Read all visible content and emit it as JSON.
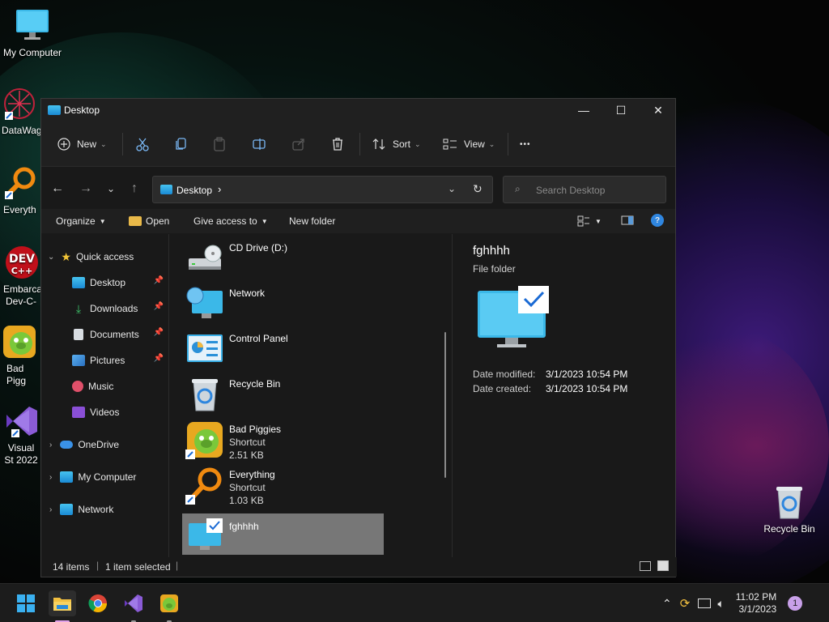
{
  "desktop": {
    "icons": [
      {
        "label": "My Computer"
      },
      {
        "label": "DataWag"
      },
      {
        "label": "Everyth"
      },
      {
        "label": "Embarca Dev-C-"
      },
      {
        "label": "Bad Pigg"
      },
      {
        "label": "Visual St 2022"
      },
      {
        "label": "Recycle Bin"
      }
    ]
  },
  "window": {
    "title": "Desktop",
    "controls": {
      "minimize": "—",
      "maximize": "☐",
      "close": "✕"
    },
    "toolbar": {
      "new_label": "New",
      "sort_label": "Sort",
      "view_label": "View",
      "more_label": "•••"
    },
    "address": {
      "path": "Desktop",
      "search_placeholder": "Search Desktop"
    },
    "command_bar": {
      "organize": "Organize",
      "open": "Open",
      "give_access": "Give access to",
      "new_folder": "New folder"
    },
    "nav": {
      "quick_access": "Quick access",
      "items": [
        {
          "label": "Desktop"
        },
        {
          "label": "Downloads"
        },
        {
          "label": "Documents"
        },
        {
          "label": "Pictures"
        },
        {
          "label": "Music"
        },
        {
          "label": "Videos"
        }
      ],
      "onedrive": "OneDrive",
      "my_computer": "My Computer",
      "network": "Network"
    },
    "files": [
      {
        "name": "CD Drive (D:)"
      },
      {
        "name": "Network"
      },
      {
        "name": "Control Panel"
      },
      {
        "name": "Recycle Bin"
      },
      {
        "name": "Bad Piggies",
        "type": "Shortcut",
        "size": "2.51 KB"
      },
      {
        "name": "Everything",
        "type": "Shortcut",
        "size": "1.03 KB"
      },
      {
        "name": "fghhhh"
      }
    ],
    "preview": {
      "name": "fghhhh",
      "kind": "File folder",
      "date_modified_label": "Date modified:",
      "date_modified": "3/1/2023 10:54 PM",
      "date_created_label": "Date created:",
      "date_created": "3/1/2023 10:54 PM"
    },
    "status": {
      "items": "14 items",
      "selected": "1 item selected"
    }
  },
  "taskbar": {
    "time": "11:02 PM",
    "date": "3/1/2023",
    "notification_count": "1"
  },
  "colors": {
    "accent": "#0078d4",
    "window_bg": "#191919",
    "selected_bg": "#777777"
  }
}
